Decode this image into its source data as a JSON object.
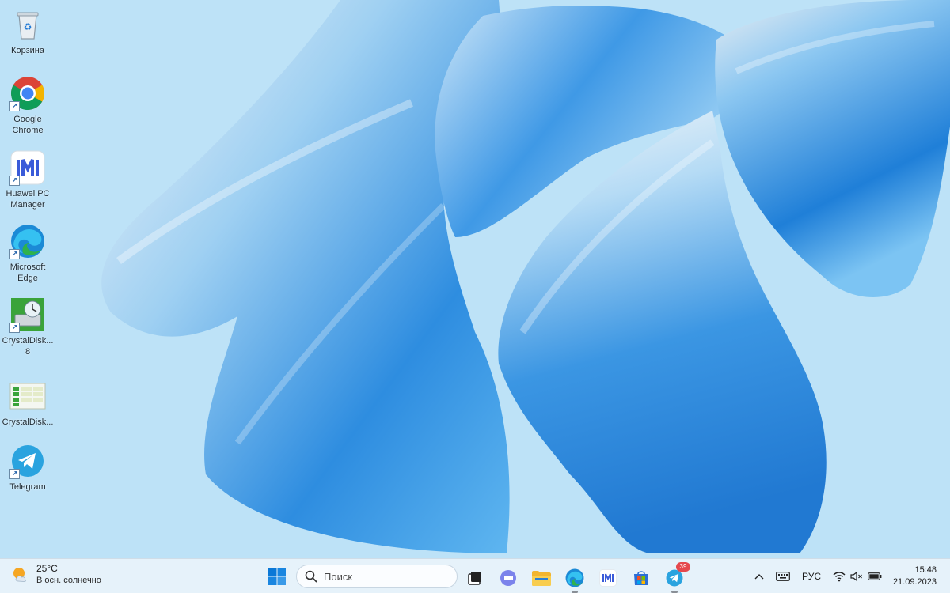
{
  "desktop": {
    "icons": [
      {
        "label": "Корзина",
        "icon": "recycle-bin-icon"
      },
      {
        "label": "Google\nChrome",
        "icon": "chrome-icon"
      },
      {
        "label": "Huawei PC\nManager",
        "icon": "huawei-pc-manager-icon"
      },
      {
        "label": "Microsoft\nEdge",
        "icon": "edge-icon"
      },
      {
        "label": "CrystalDisk...\n8",
        "icon": "crystaldiskinfo-icon"
      },
      {
        "label": "CrystalDisk...",
        "icon": "crystaldiskmark-icon"
      },
      {
        "label": "Telegram",
        "icon": "telegram-icon"
      }
    ]
  },
  "taskbar": {
    "weather": {
      "temp": "25°C",
      "condition": "В осн. солнечно",
      "icon": "sun-cloud-icon"
    },
    "search_placeholder": "Поиск",
    "apps": [
      {
        "name": "task-view",
        "icon": "task-view-icon"
      },
      {
        "name": "teams-chat",
        "icon": "teams-icon"
      },
      {
        "name": "file-explorer",
        "icon": "folder-icon"
      },
      {
        "name": "edge",
        "icon": "edge-icon"
      },
      {
        "name": "huawei-pc-manager",
        "icon": "huawei-pc-manager-icon"
      },
      {
        "name": "microsoft-store",
        "icon": "store-icon"
      },
      {
        "name": "telegram",
        "icon": "telegram-icon",
        "badge": "39"
      }
    ],
    "tray": {
      "language": "РУС",
      "time": "15:48",
      "date": "21.09.2023"
    }
  },
  "colors": {
    "wallpaper_bg": "#b9dff6",
    "taskbar_bg": "#e8f2fa",
    "badge_red": "#e5484d",
    "windows_blue": "#0078d4"
  }
}
